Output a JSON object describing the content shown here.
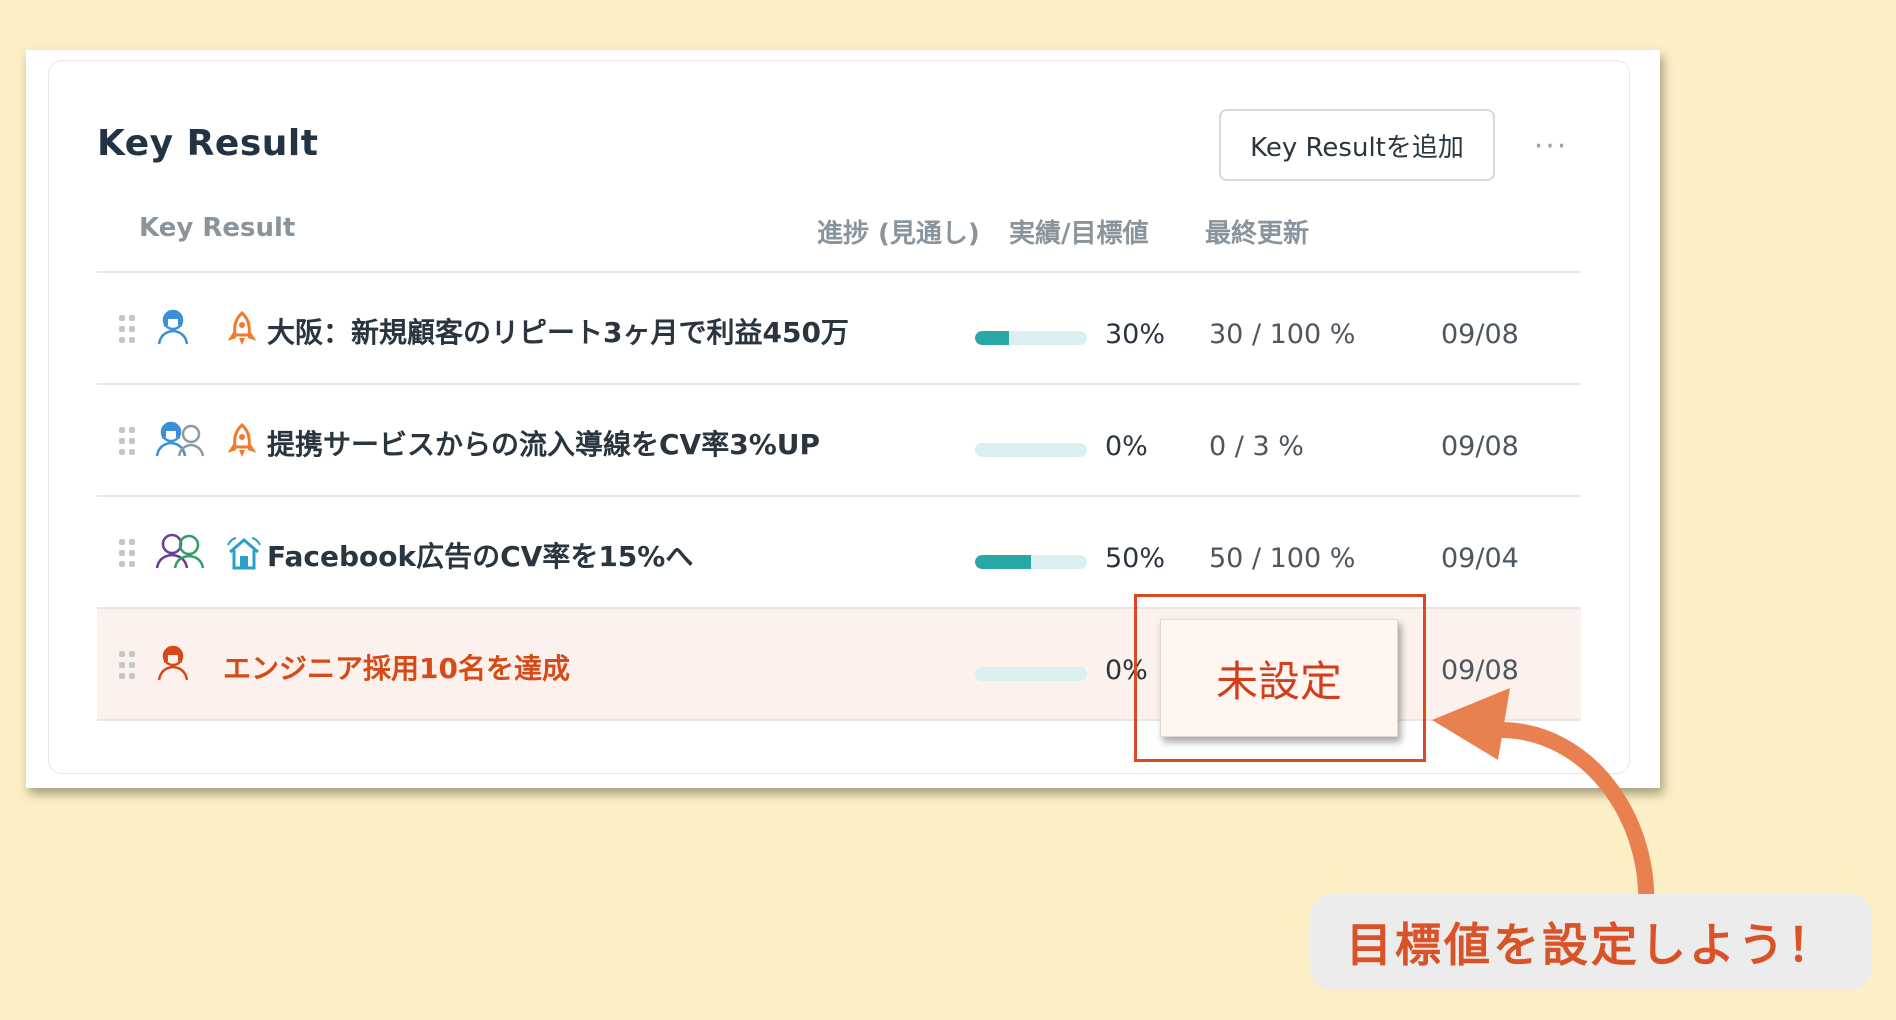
{
  "card": {
    "title": "Key Result",
    "add_button": "Key Resultを追加",
    "more_label": "···"
  },
  "table": {
    "headers": {
      "key_result": "Key Result",
      "progress": "進捗 (見通し)",
      "actual_target": "実績/目標値",
      "last_updated": "最終更新"
    },
    "rows": [
      {
        "title": "大阪：新規顧客のリピート3ヶ月で利益450万",
        "progress": 0.3,
        "progress_text": "30%",
        "actual_target": "30 / 100 %",
        "last_updated": "09/08"
      },
      {
        "title": "提携サービスからの流入導線をCV率3%UP",
        "progress": 0.0,
        "progress_text": "0%",
        "actual_target": "0 / 3 %",
        "last_updated": "09/08"
      },
      {
        "title": "Facebook広告のCV率を15%へ",
        "progress": 0.5,
        "progress_text": "50%",
        "actual_target": "50 / 100 %",
        "last_updated": "09/04"
      },
      {
        "title": "エンジニア採用10名を達成",
        "progress": 0.0,
        "progress_text": "0%",
        "actual_target": "未設定",
        "last_updated": "09/08"
      }
    ]
  },
  "callout": {
    "text": "目標値を設定しよう！"
  },
  "colors": {
    "background": "#fdefc5",
    "accent_red": "#d94a20",
    "progress_fill": "#2aa8a8",
    "progress_track": "#d9eff0",
    "alert_row": "#fcf1ec"
  }
}
